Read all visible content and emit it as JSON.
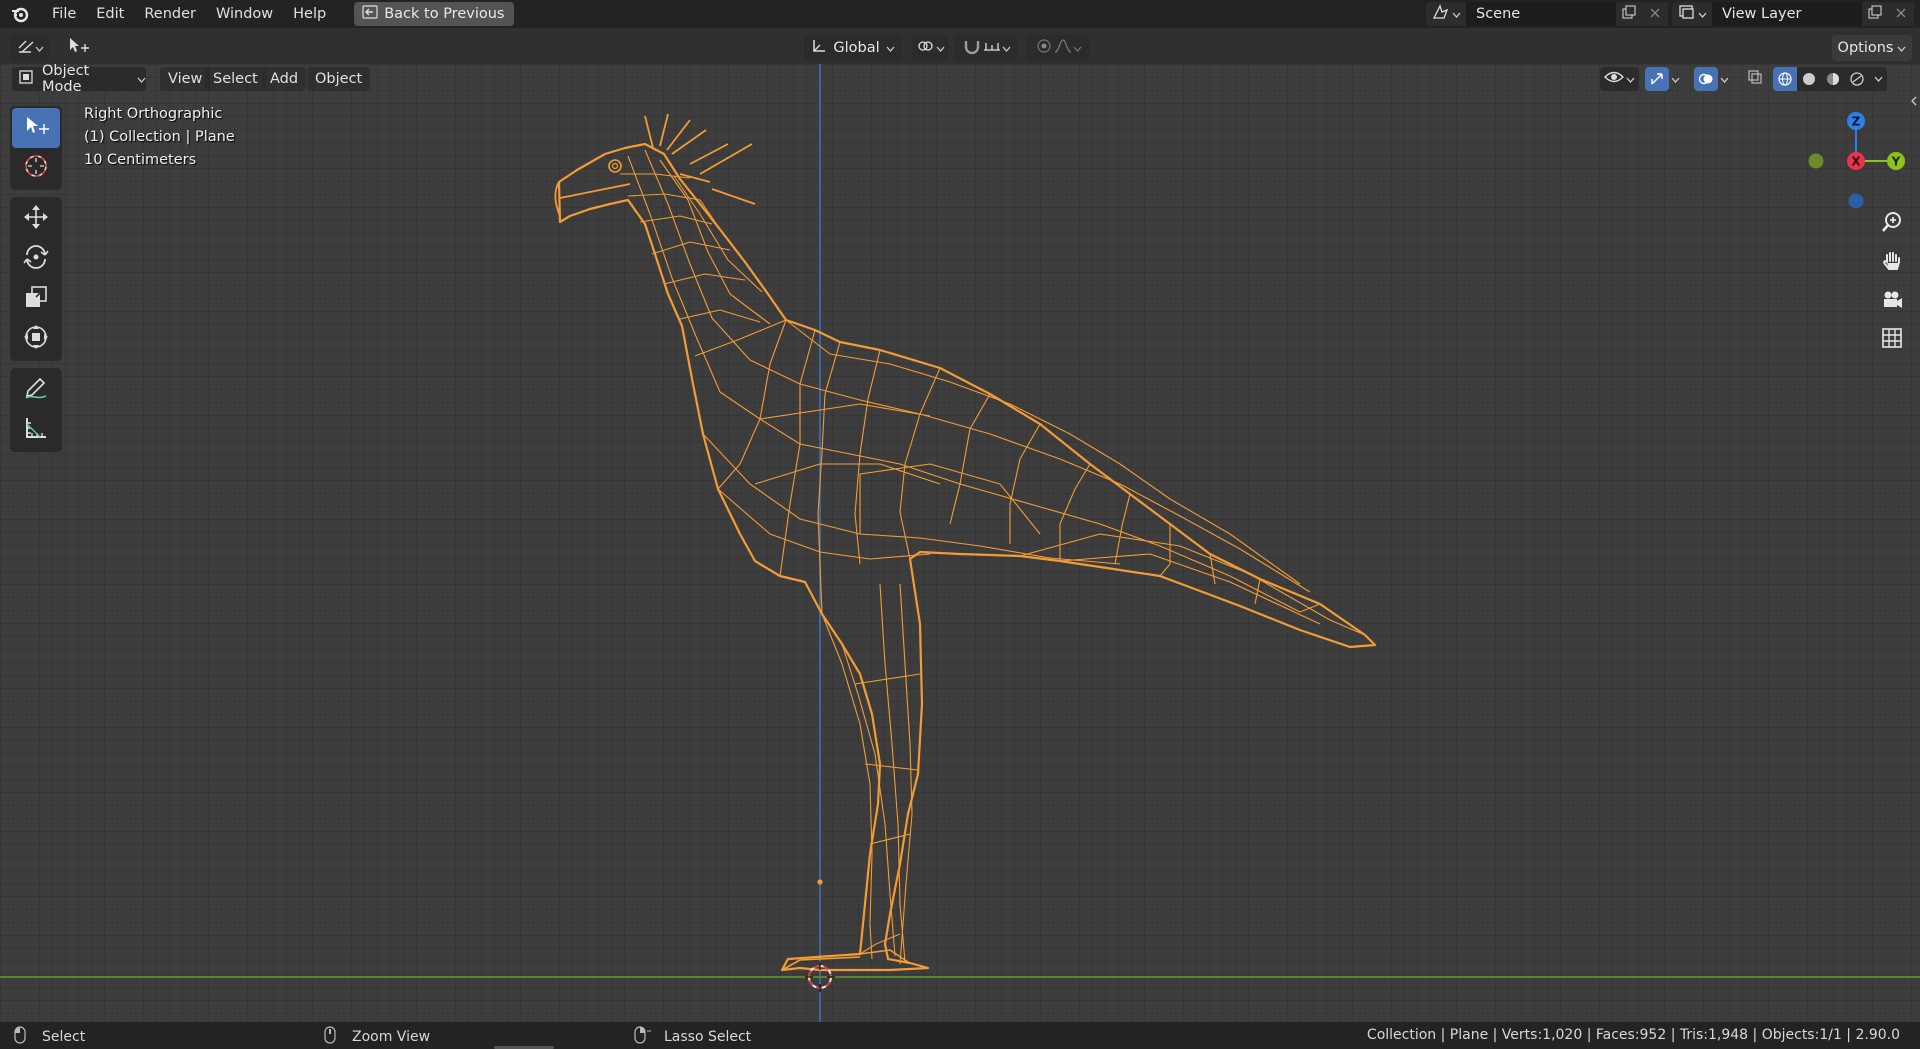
{
  "menubar": {
    "items": [
      "File",
      "Edit",
      "Render",
      "Window",
      "Help"
    ],
    "back_button": "Back to Previous",
    "scene_name": "Scene",
    "view_layer_name": "View Layer"
  },
  "toolheader": {
    "orientation": "Global",
    "options_label": "Options"
  },
  "viewport_header": {
    "mode": "Object Mode",
    "menus": [
      "View",
      "Select",
      "Add",
      "Object"
    ]
  },
  "overlay_info": {
    "view_name": "Right Orthographic",
    "collection_line": "(1) Collection | Plane",
    "scale_line": "10 Centimeters"
  },
  "toolbar": {
    "tools": [
      "select-box",
      "cursor",
      "move",
      "rotate",
      "scale",
      "transform",
      "annotate",
      "measure"
    ],
    "active_tool": "select-box"
  },
  "gizmo": {
    "axes": {
      "z": "Z",
      "x": "X",
      "y": "Y"
    },
    "colors": {
      "z": "#2f7fe8",
      "x": "#e8344f",
      "y": "#8bc41d"
    },
    "nav_buttons": [
      "zoom-icon",
      "pan-hand-icon",
      "camera-icon",
      "grid-icon"
    ]
  },
  "statusbar": {
    "left_action": "Select",
    "middle_action": "Zoom View",
    "right_action": "Lasso Select",
    "stats": "Collection | Plane | Verts:1,020 | Faces:952 | Tris:1,948 | Objects:1/1 | 2.90.0"
  },
  "colors": {
    "wire_selected": "#f39c36",
    "axis_y_line": "#6b9a2f",
    "axis_z_line": "#3b78c0",
    "active_tool": "#4772b3"
  }
}
